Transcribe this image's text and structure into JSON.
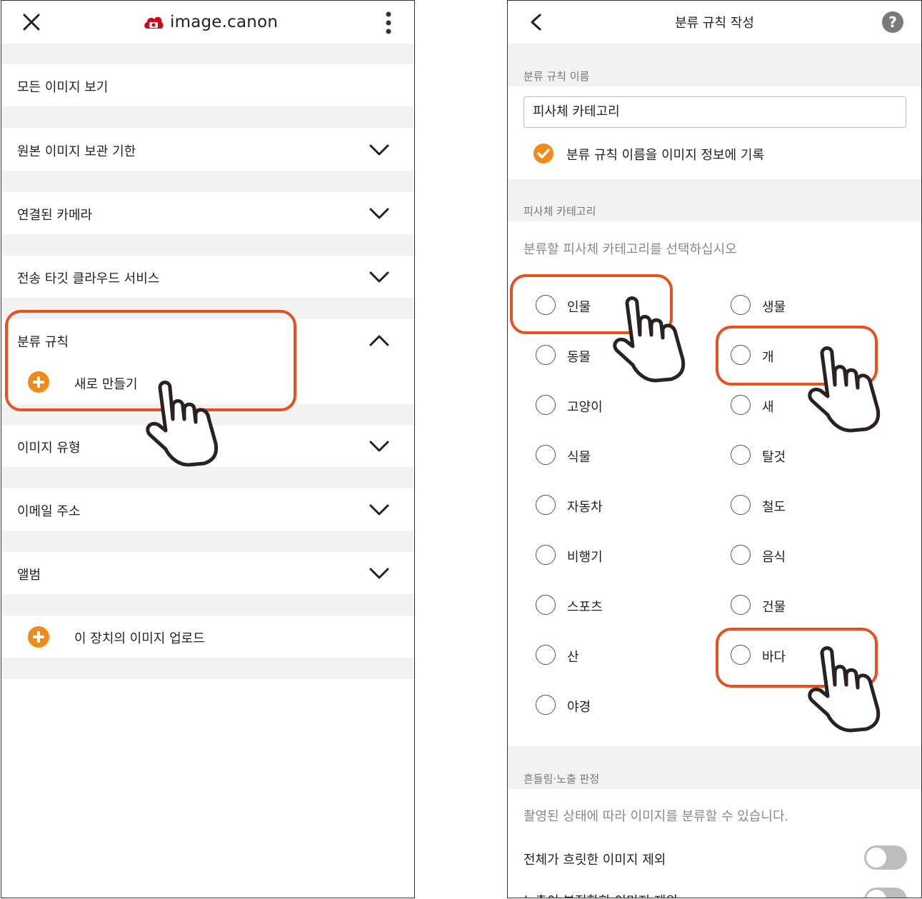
{
  "left": {
    "logo_text": "image.canon",
    "menu": {
      "all_images": "모든 이미지 보기",
      "retention": "원본 이미지 보관 기한",
      "cameras": "연결된 카메라",
      "cloud": "전송 타깃 클라우드 서비스",
      "rules": "분류 규칙",
      "new_rule": "새로 만들기",
      "image_type": "이미지 유형",
      "email": "이메일 주소",
      "album": "앨범",
      "upload": "이 장치의 이미지 업로드"
    }
  },
  "right": {
    "title": "분류 규칙 작성",
    "help": "?",
    "name_section": "분류 규칙 이름",
    "name_value": "피사체 카테고리",
    "record_label": "분류 규칙 이름을 이미지 정보에 기록",
    "category_section": "피사체 카테고리",
    "category_hint": "분류할 피사체 카테고리를 선택하십시오",
    "categories_left": [
      "인물",
      "동물",
      "고양이",
      "식물",
      "자동차",
      "비행기",
      "스포츠",
      "산",
      "야경"
    ],
    "categories_right": [
      "생물",
      "개",
      "새",
      "탈것",
      "철도",
      "음식",
      "건물",
      "바다"
    ],
    "blur_section": "흔들림·노출 판정",
    "blur_hint": "촬영된 상태에 따라 이미지를 분류할 수 있습니다.",
    "toggle1": "전체가 흐릿한 이미지 제외",
    "toggle2": "노출이 부적합한 이미지 제외",
    "toggle1_on": false,
    "toggle2_on": false
  },
  "colors": {
    "accent": "#f28a1b",
    "highlight": "#e8511f",
    "logo_red": "#d6001c",
    "section_bg": "#f2f2f2"
  }
}
